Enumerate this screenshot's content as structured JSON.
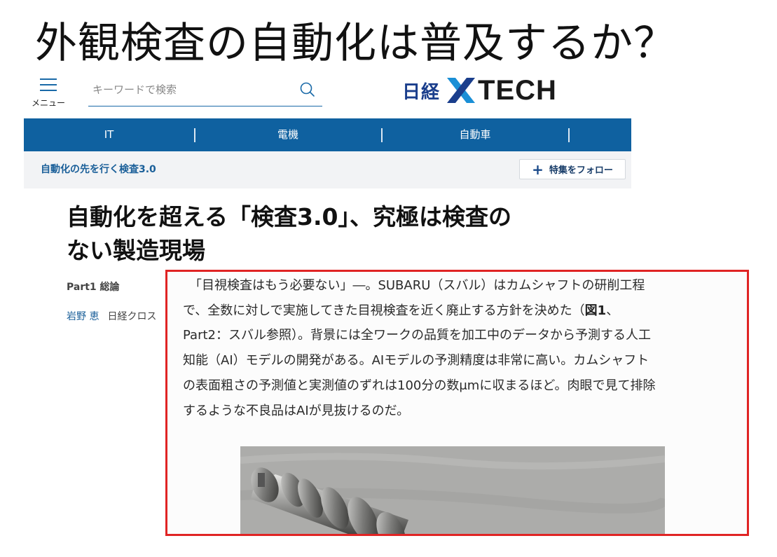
{
  "slide": {
    "title": "外観検査の自動化は普及するか？"
  },
  "header": {
    "menu_label": "メニュー",
    "search_placeholder": "キーワードで検索",
    "logo_jp": "日経",
    "logo_en": "TECH"
  },
  "nav": {
    "items": [
      "IT",
      "電機",
      "自動車"
    ]
  },
  "feature": {
    "title": "自動化の先を行く検査3.0",
    "follow_label": "特集をフォロー"
  },
  "article": {
    "title_line1": "自動化を超える「検査3.0」、究極は検査の",
    "title_line2": "ない製造現場",
    "part": "Part1 総論",
    "author": "岩野 恵",
    "publication": "日経クロス"
  },
  "excerpt": {
    "line1": "「目視検査はもう必要ない」―。SUBARU（スバル）はカムシャフトの研削工程",
    "line2_pre": "で、全数に対しで実施してきた目視検査を近く廃止する方針を決めた（",
    "line2_bold": "図1",
    "line2_post": "、",
    "line3": "Part2：スバル参照）。背景には全ワークの品質を加工中のデータから予測する人工",
    "line4": "知能（AI）モデルの開発がある。AIモデルの予測精度は非常に高い。カムシャフト",
    "line5": "の表面粗さの予測値と実測値のずれは100分の数μmに収まるほど。肉眼で見て排除",
    "line6": "するような不良品はAIが見抜けるのだ。"
  },
  "colors": {
    "nav_blue": "#0f61a0",
    "highlight_red": "#e02424",
    "logo_navy": "#1a3e8c"
  }
}
